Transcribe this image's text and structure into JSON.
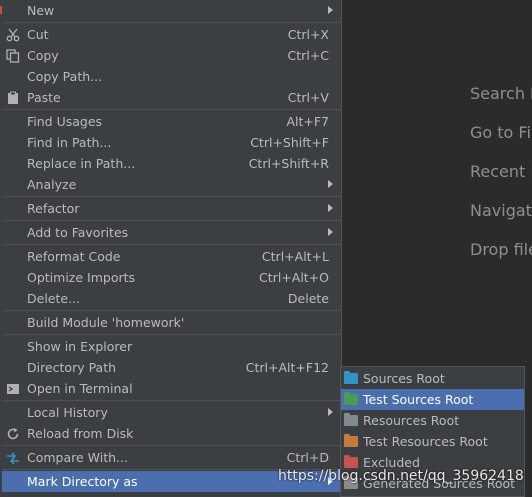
{
  "editor_hints": [
    "Search E",
    "Go to Fi",
    "Recent F",
    "Navigati",
    "Drop file"
  ],
  "context_menu": {
    "items": [
      {
        "id": "new",
        "label": "New",
        "shortcut": "",
        "submenu": true
      },
      {
        "sep": true
      },
      {
        "id": "cut",
        "label": "Cut",
        "shortcut": "Ctrl+X",
        "icon": "scissors-icon"
      },
      {
        "id": "copy",
        "label": "Copy",
        "shortcut": "Ctrl+C",
        "icon": "copy-icon"
      },
      {
        "id": "copy-path",
        "label": "Copy Path...",
        "shortcut": ""
      },
      {
        "id": "paste",
        "label": "Paste",
        "shortcut": "Ctrl+V",
        "icon": "clipboard-icon"
      },
      {
        "sep": true
      },
      {
        "id": "find-usages",
        "label": "Find Usages",
        "shortcut": "Alt+F7"
      },
      {
        "id": "find-in-path",
        "label": "Find in Path...",
        "shortcut": "Ctrl+Shift+F"
      },
      {
        "id": "replace-in-path",
        "label": "Replace in Path...",
        "shortcut": "Ctrl+Shift+R"
      },
      {
        "id": "analyze",
        "label": "Analyze",
        "shortcut": "",
        "submenu": true
      },
      {
        "sep": true
      },
      {
        "id": "refactor",
        "label": "Refactor",
        "shortcut": "",
        "submenu": true
      },
      {
        "sep": true
      },
      {
        "id": "add-to-favorites",
        "label": "Add to Favorites",
        "shortcut": "",
        "submenu": true
      },
      {
        "sep": true
      },
      {
        "id": "reformat-code",
        "label": "Reformat Code",
        "shortcut": "Ctrl+Alt+L"
      },
      {
        "id": "optimize-imports",
        "label": "Optimize Imports",
        "shortcut": "Ctrl+Alt+O"
      },
      {
        "id": "delete",
        "label": "Delete...",
        "shortcut": "Delete"
      },
      {
        "sep": true
      },
      {
        "id": "build-module",
        "label": "Build Module 'homework'",
        "shortcut": ""
      },
      {
        "sep": true
      },
      {
        "id": "show-in-explorer",
        "label": "Show in Explorer",
        "shortcut": ""
      },
      {
        "id": "directory-path",
        "label": "Directory Path",
        "shortcut": "Ctrl+Alt+F12"
      },
      {
        "id": "open-in-terminal",
        "label": "Open in Terminal",
        "shortcut": "",
        "icon": "terminal-icon"
      },
      {
        "sep": true
      },
      {
        "id": "local-history",
        "label": "Local History",
        "shortcut": "",
        "submenu": true
      },
      {
        "id": "reload-from-disk",
        "label": "Reload from Disk",
        "shortcut": "",
        "icon": "reload-icon"
      },
      {
        "sep": true
      },
      {
        "id": "compare-with",
        "label": "Compare With...",
        "shortcut": "Ctrl+D",
        "icon": "compare-icon"
      },
      {
        "sep": true
      },
      {
        "id": "mark-directory-as",
        "label": "Mark Directory as",
        "shortcut": "",
        "submenu": true,
        "selected": true
      }
    ]
  },
  "submenu": {
    "items": [
      {
        "id": "sources-root",
        "label": "Sources Root",
        "icon": "blue-folder-icon",
        "color": "#3592c4"
      },
      {
        "id": "test-sources-root",
        "label": "Test Sources Root",
        "icon": "green-folder-icon",
        "color": "#499c54",
        "selected": true
      },
      {
        "id": "resources-root",
        "label": "Resources Root",
        "icon": "resources-folder-icon",
        "color": "#7f8b91"
      },
      {
        "id": "test-resources-root",
        "label": "Test Resources Root",
        "icon": "test-resources-folder-icon",
        "color": "#c47a3a"
      },
      {
        "id": "excluded",
        "label": "Excluded",
        "icon": "orange-folder-icon",
        "color": "#c75450"
      },
      {
        "id": "generated-sources-root",
        "label": "Generated Sources Root",
        "icon": "generated-folder-icon",
        "color": "#8a8a8a"
      }
    ]
  },
  "watermark": "https://blog.csdn.net/qq_35962418",
  "colors": {
    "selection": "#4b6eaf",
    "menu_bg": "#3c3f41",
    "editor_bg": "#2b2b2b"
  }
}
